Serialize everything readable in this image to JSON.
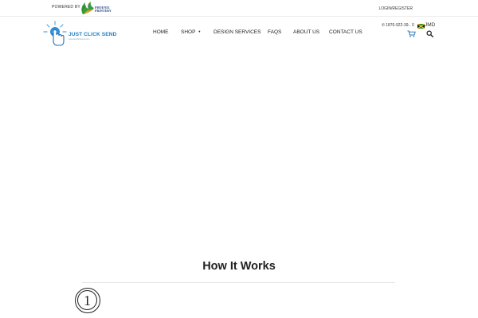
{
  "topbar": {
    "powered_by": "POWERED BY",
    "partner_name_line1": "PHOENIX",
    "partner_name_line2": "PRINTERY",
    "login_register": "LOGIN/REGISTER"
  },
  "brand": {
    "name": "JUST CLICK SEND",
    "tagline": "www.justclicksend.com",
    "accent": "#1f7dc2"
  },
  "nav": {
    "items": [
      {
        "label": "HOME"
      },
      {
        "label": "SHOP",
        "has_dropdown": true
      },
      {
        "label": "DESIGN SERVICES"
      },
      {
        "label": "FAQS"
      },
      {
        "label": "ABOUT US"
      },
      {
        "label": "CONTACT US"
      }
    ]
  },
  "header_tools": {
    "phone": "1876-922-39..",
    "phone_icon": "phone-icon",
    "cart_count": "0",
    "currency": "JMD",
    "cart_icon": "cart-icon",
    "search_icon": "search-icon"
  },
  "section": {
    "title": "How It Works",
    "step_number": "1"
  }
}
